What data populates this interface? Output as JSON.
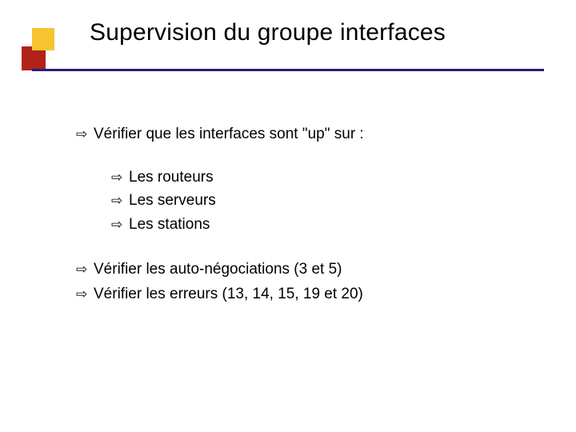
{
  "title": "Supervision du  groupe interfaces",
  "bullets": {
    "b1": "Vérifier que les interfaces sont \"up\" sur :",
    "sub1": "Les routeurs",
    "sub2": "Les serveurs",
    "sub3": "Les stations",
    "b2": "Vérifier les auto-négociations (3 et 5)",
    "b3": "Vérifier les erreurs (13, 14, 15, 19 et 20)"
  },
  "glyphs": {
    "arrow": "⇨"
  }
}
